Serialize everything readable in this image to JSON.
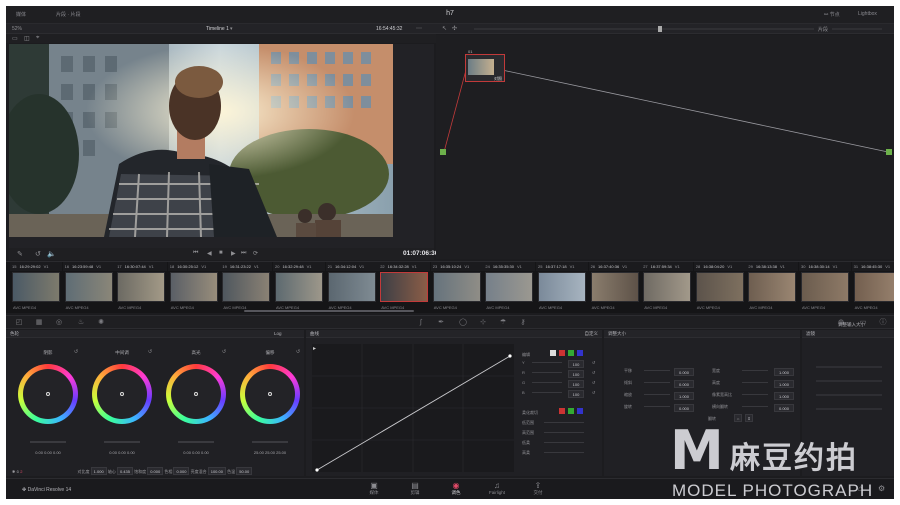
{
  "topbar": {
    "left_btn1": "媒体",
    "left_btn2": "片段 · 片段",
    "project_title": "h7",
    "right_btn1": "节点",
    "right_btn2": "Lightbox"
  },
  "toolbar": {
    "zoom": "52%",
    "timeline_name": "Timeline 1",
    "timecode": "16:54:45:32",
    "node_label": "片段"
  },
  "viewer": {
    "current_tc": "01:07:06:36"
  },
  "node": {
    "number": "01",
    "label": "对照"
  },
  "clips": [
    {
      "n": "15",
      "tc": "16:29:29:02",
      "tr": "V1",
      "name": "AVC MPEG4",
      "sel": false,
      "c": [
        "#4b5a66",
        "#7d7a6c"
      ]
    },
    {
      "n": "16",
      "tc": "16:23:59:48",
      "tr": "V1",
      "name": "AVC MPEG4",
      "sel": false,
      "c": [
        "#5f6d75",
        "#8a8678"
      ]
    },
    {
      "n": "17",
      "tc": "16:30:07:44",
      "tr": "V1",
      "name": "AVC MPEG4",
      "sel": false,
      "c": [
        "#6c6a63",
        "#a39a87"
      ]
    },
    {
      "n": "18",
      "tc": "16:30:25:12",
      "tr": "V1",
      "name": "AVC MPEG4",
      "sel": false,
      "c": [
        "#5a5f66",
        "#988d7b"
      ]
    },
    {
      "n": "19",
      "tc": "16:31:23:22",
      "tr": "V1",
      "name": "AVC MPEG4",
      "sel": false,
      "c": [
        "#4f575e",
        "#8a8174"
      ]
    },
    {
      "n": "20",
      "tc": "16:32:29:48",
      "tr": "V1",
      "name": "AVC MPEG4",
      "sel": false,
      "c": [
        "#5d6a70",
        "#9d978a"
      ]
    },
    {
      "n": "21",
      "tc": "16:34:12:04",
      "tr": "V1",
      "name": "AVC MPEG4",
      "sel": false,
      "c": [
        "#5b6770",
        "#7f8b93"
      ]
    },
    {
      "n": "22",
      "tc": "16:34:32:28",
      "tr": "V1",
      "name": "AVC MPEG4",
      "sel": true,
      "c": [
        "#3d3f45",
        "#8b5d47"
      ]
    },
    {
      "n": "23",
      "tc": "16:35:10:24",
      "tr": "V1",
      "name": "AVC MPEG4",
      "sel": false,
      "c": [
        "#66737d",
        "#8f8d86"
      ]
    },
    {
      "n": "24",
      "tc": "16:35:35:30",
      "tr": "V1",
      "name": "AVC MPEG4",
      "sel": false,
      "c": [
        "#76808a",
        "#9b9890"
      ]
    },
    {
      "n": "25",
      "tc": "16:37:17:18",
      "tr": "V1",
      "name": "AVC MPEG4",
      "sel": false,
      "c": [
        "#7b8a9a",
        "#a7b4c0"
      ]
    },
    {
      "n": "26",
      "tc": "16:37:40:36",
      "tr": "V1",
      "name": "AVC MPEG4",
      "sel": false,
      "c": [
        "#8a7d6d",
        "#5e5248"
      ]
    },
    {
      "n": "27",
      "tc": "16:37:59:34",
      "tr": "V1",
      "name": "AVC MPEG4",
      "sel": false,
      "c": [
        "#6f6a63",
        "#a2998a"
      ]
    },
    {
      "n": "28",
      "tc": "16:38:04:20",
      "tr": "V1",
      "name": "AVC MPEG4",
      "sel": false,
      "c": [
        "#5c534b",
        "#7e705f"
      ]
    },
    {
      "n": "29",
      "tc": "16:38:13:38",
      "tr": "V1",
      "name": "AVC MPEG4",
      "sel": false,
      "c": [
        "#6e5e50",
        "#9a8672"
      ]
    },
    {
      "n": "30",
      "tc": "16:38:30:14",
      "tr": "V1",
      "name": "AVC MPEG4",
      "sel": false,
      "c": [
        "#6b5c4e",
        "#8e7a67"
      ]
    },
    {
      "n": "31",
      "tc": "16:38:45:30",
      "tr": "V1",
      "name": "AVC MPEG4",
      "sel": false,
      "c": [
        "#735f4f",
        "#9a8470"
      ]
    },
    {
      "n": "32",
      "tc": "16:38:59:34",
      "tr": "V1",
      "name": "AVC MPEG4",
      "sel": false,
      "c": [
        "#655649",
        "#857360"
      ]
    }
  ],
  "wheels": {
    "header": "色轮",
    "mode": "Log",
    "items": [
      {
        "label": "阴影",
        "vals": "0.00  0.00  0.00"
      },
      {
        "label": "中间调",
        "vals": "0.00  0.00  0.00"
      },
      {
        "label": "高光",
        "vals": "0.00  0.00  0.00"
      },
      {
        "label": "偏移",
        "vals": "25.00  25.00  25.00"
      }
    ],
    "footer": {
      "contrast_label": "对比度",
      "contrast": "1.000",
      "pivot_label": "轴心",
      "pivot": "0.435",
      "sat_label": "饱和度",
      "sat": "0.000",
      "hue_label": "色相",
      "hue": "0.000",
      "lum_label": "亮度混合",
      "lum": "100.00",
      "extra_label": "色温",
      "extra": "50.00",
      "page": "2"
    }
  },
  "curves": {
    "header": "曲线",
    "mode": "自定义",
    "edit_label": "编辑",
    "channels": [
      {
        "label": "Y",
        "val": "100"
      },
      {
        "label": "R",
        "val": "100"
      },
      {
        "label": "G",
        "val": "100"
      },
      {
        "label": "B",
        "val": "100"
      }
    ],
    "soft_label": "柔化裁切",
    "soft_rows": [
      "低范围",
      "高范围",
      "低柔",
      "高柔"
    ]
  },
  "adjust": {
    "header": "调整大小",
    "sub": "调整输入大小",
    "left_rows": [
      {
        "label": "平移",
        "val": "0.000"
      },
      {
        "label": "倾斜",
        "val": "0.000"
      },
      {
        "label": "缩放",
        "val": "1.000"
      },
      {
        "label": "旋转",
        "val": "0.000"
      }
    ],
    "right_rows": [
      {
        "label": "宽度",
        "val": "1.000"
      },
      {
        "label": "高度",
        "val": "1.000"
      },
      {
        "label": "像素宽高比",
        "val": "1.000"
      },
      {
        "label": "横向翻转",
        "val": "0.000"
      }
    ],
    "flip_label": "翻转",
    "side_header": "滤镜"
  },
  "bottom_nav": {
    "app": "DaVinci Resolve 14",
    "tabs": [
      {
        "icon": "▣",
        "label": "媒体"
      },
      {
        "icon": "▤",
        "label": "剪辑"
      },
      {
        "icon": "◉",
        "label": "调色"
      },
      {
        "icon": "♫",
        "label": "Fairlight"
      },
      {
        "icon": "⇪",
        "label": "交付"
      }
    ]
  },
  "watermark": {
    "logo_letter": "M",
    "cn_text": "麻豆约拍",
    "en_text": "MODEL PHOTOGRAPH"
  },
  "colors": {
    "accent": "#e34a68",
    "node_green": "#6db14b",
    "selection": "#c23a3a"
  }
}
